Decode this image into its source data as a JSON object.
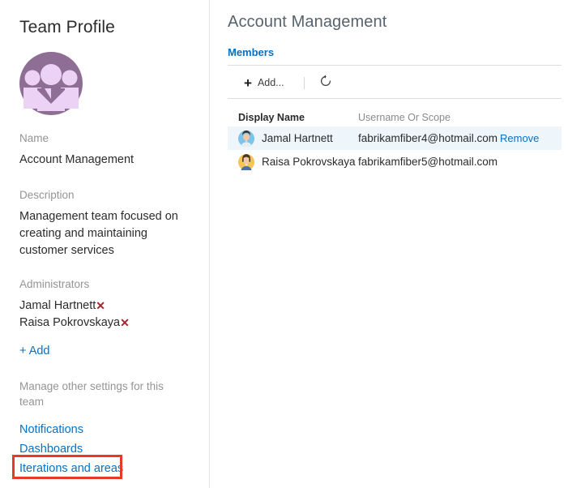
{
  "sidebar": {
    "title": "Team Profile",
    "avatar_icon": "team-group-icon",
    "avatar_bg_color": "#8f6e96",
    "avatar_fg_color": "#ecd3f5",
    "name": {
      "label": "Name",
      "value": "Account Management"
    },
    "description": {
      "label": "Description",
      "value": "Management team focused on creating and maintaining customer services"
    },
    "administrators": {
      "label": "Administrators",
      "remove_glyph": "✕",
      "items": [
        {
          "name": "Jamal Hartnett"
        },
        {
          "name": "Raisa Pokrovskaya"
        }
      ],
      "add_label": "+ Add"
    },
    "manage": {
      "heading": "Manage other settings for this team",
      "links": [
        {
          "label": "Notifications"
        },
        {
          "label": "Dashboards"
        },
        {
          "label": "Iterations and areas"
        }
      ]
    },
    "annotation": {
      "target_label": "Iterations and areas",
      "color": "#e8382a"
    }
  },
  "content": {
    "title": "Account Management",
    "tabs": [
      {
        "label": "Members",
        "active": true
      }
    ],
    "toolbar": {
      "add_label": "Add...",
      "add_icon": "plus-icon",
      "refresh_icon": "refresh-icon"
    },
    "table": {
      "columns": [
        "Display Name",
        "Username Or Scope"
      ],
      "action_label": "Remove",
      "rows": [
        {
          "display_name": "Jamal Hartnett",
          "username_or_scope": "fabrikamfiber4@hotmail.com",
          "action": "Remove",
          "selected": true,
          "avatar_color": "#5ab3e0"
        },
        {
          "display_name": "Raisa Pokrovskaya",
          "username_or_scope": "fabrikamfiber5@hotmail.com",
          "action": "",
          "selected": false,
          "avatar_color": "#f0b429"
        }
      ]
    }
  },
  "colors": {
    "accent_blue": "#0571c4",
    "selected_row": "#eef6fc",
    "remove_red": "#a4262c",
    "annotation_red": "#e8382a"
  }
}
